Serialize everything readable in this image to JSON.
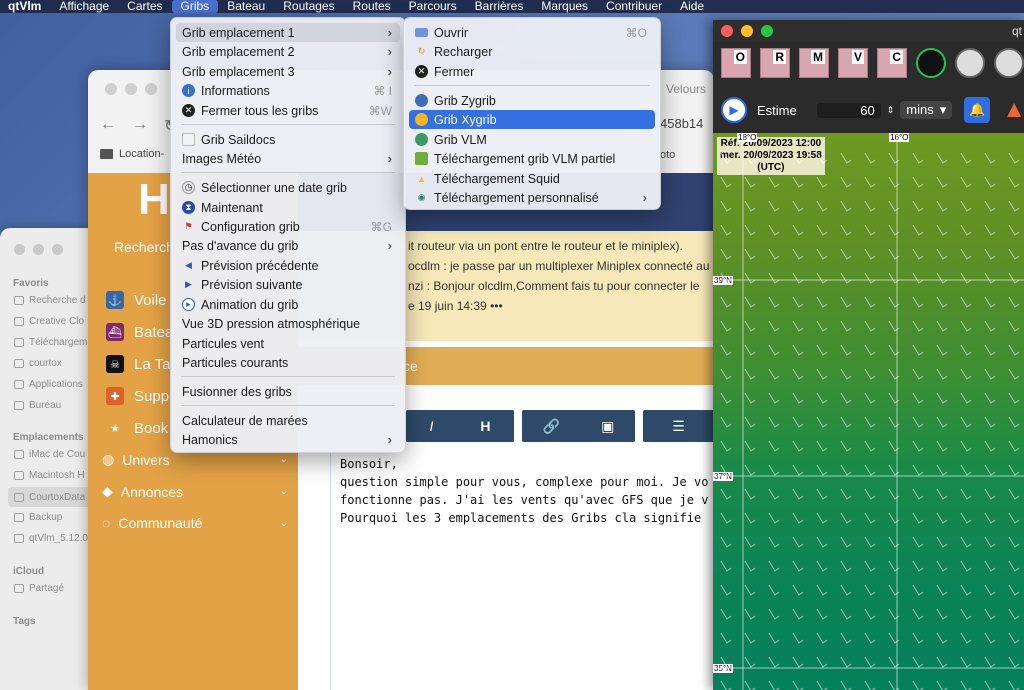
{
  "menubar": {
    "app": "qtVlm",
    "items": [
      "Affichage",
      "Cartes",
      "Gribs",
      "Bateau",
      "Routages",
      "Routes",
      "Parcours",
      "Barrières",
      "Marques",
      "Contribuer",
      "Aide"
    ],
    "active": "Gribs"
  },
  "finder": {
    "favorites_header": "Favoris",
    "favorites": [
      "Recherche d",
      "Creative Clo",
      "Téléchargem",
      "courtox",
      "Applications",
      "Bureau"
    ],
    "locations_header": "Emplacements",
    "locations": [
      "iMac de Cou",
      "Macintosh H",
      "CourtoxData",
      "Backup",
      "qtVlm_5.12.0"
    ],
    "icloud_header": "iCloud",
    "icloud": [
      "Partagé"
    ],
    "tags_header": "Tags"
  },
  "browser": {
    "tab_partial": "Velours",
    "hash_partial": "458b14",
    "bookmark": "Location-",
    "photo_partial": "oto",
    "logo": "H",
    "search_partial": "Recherch",
    "nav_items": [
      "Voile",
      "Batea",
      "La Tav",
      "Suppo",
      "Book"
    ],
    "nav_groups": [
      "Univers",
      "Annonces",
      "Communauté"
    ],
    "lines": [
      "it routeur via un pont entre le routeur et le miniplex).",
      "ocdlm : je passe par un multiplexer Miniplex connecté au",
      "nzi : Bonjour olcdlm,Comment fais tu pour connecter le",
      "e 19 juin 14:39  •••"
    ],
    "section_partial": "ce",
    "toolbar_buttons": [
      "I",
      "H",
      "🔗",
      "▣",
      "☰"
    ],
    "editor_lines": [
      "Bonsoir,",
      "question simple pour vous, complexe pour moi. Je vo",
      "fonctionne pas. J'ai les vents qu'avec GFS que je v",
      "Pourquoi les 3 emplacements des Gribs cla signifie"
    ]
  },
  "gribs_menu": {
    "items": [
      {
        "label": "Grib emplacement 1",
        "submenu": true,
        "highlight": true
      },
      {
        "label": "Grib emplacement 2",
        "submenu": true
      },
      {
        "label": "Grib emplacement 3",
        "submenu": true
      },
      {
        "label": "Informations",
        "shortcut": "⌘ I",
        "icon": "info-icon"
      },
      {
        "label": "Fermer tous les gribs",
        "shortcut": "⌘W",
        "icon": "close-circle-icon"
      },
      {
        "label": "Grib Saildocs",
        "icon": "document-icon"
      },
      {
        "label": "Images Météo",
        "submenu": true
      },
      {
        "label": "Sélectionner une date grib",
        "icon": "clock-icon"
      },
      {
        "label": "Maintenant",
        "icon": "hourglass-icon"
      },
      {
        "label": "Configuration grib",
        "shortcut": "⌘G",
        "icon": "config-icon"
      },
      {
        "label": "Pas d'avance du grib",
        "submenu": true
      },
      {
        "label": "Prévision précédente",
        "icon": "previous-icon"
      },
      {
        "label": "Prévision suivante",
        "icon": "next-icon"
      },
      {
        "label": "Animation du grib",
        "icon": "play-icon"
      },
      {
        "label": "Vue 3D pression atmosphérique"
      },
      {
        "label": "Particules vent"
      },
      {
        "label": "Particules courants"
      },
      {
        "label": "Fusionner des gribs"
      },
      {
        "label": "Calculateur de marées"
      },
      {
        "label": "Hamonics",
        "submenu": true
      }
    ]
  },
  "grib1_submenu": {
    "items": [
      {
        "label": "Ouvrir",
        "shortcut": "⌘O",
        "icon": "folder-icon"
      },
      {
        "label": "Recharger",
        "icon": "reload-icon"
      },
      {
        "label": "Fermer",
        "icon": "close-circle-icon"
      },
      {
        "label": "Grib Zygrib",
        "icon": "globe-icon"
      },
      {
        "label": "Grib Xygrib",
        "icon": "sun-icon",
        "selected": true
      },
      {
        "label": "Grib VLM",
        "icon": "vlm-icon"
      },
      {
        "label": "Téléchargement grib VLM partiel",
        "icon": "download-icon"
      },
      {
        "label": "Téléchargement Squid",
        "icon": "squid-icon"
      },
      {
        "label": "Téléchargement personnalisé",
        "icon": "eye-icon",
        "submenu": true
      }
    ]
  },
  "qtvlm": {
    "title_partial": "qt",
    "toolbar_buttons": [
      "O",
      "R",
      "M",
      "V",
      "C"
    ],
    "estime_label": "Estime",
    "estime_value": "60",
    "unit": "mins",
    "map": {
      "ref_line1": "Réf: 20/09/2023 12:00",
      "ref_line2": "mer. 20/09/2023 19:58",
      "ref_line3": "(UTC)",
      "lon_labels": [
        "18°O",
        "16°O"
      ],
      "lat_labels": [
        "39°N",
        "37°N",
        "35°N"
      ]
    }
  }
}
